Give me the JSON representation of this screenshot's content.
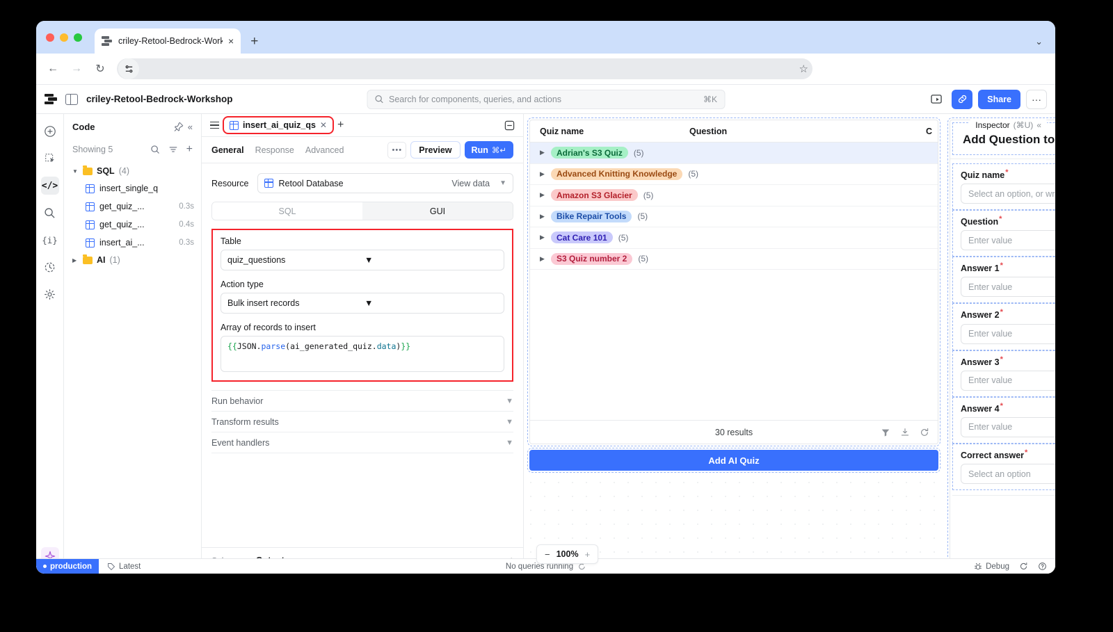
{
  "browser": {
    "tab_title": "criley-Retool-Bedrock-Works",
    "tab_close": "×",
    "new_tab": "+",
    "tabstrip_chevron": "⌄",
    "back": "←",
    "forward": "→",
    "reload": "↻",
    "address_value": "",
    "star": "☆"
  },
  "topbar": {
    "app_title": "criley-Retool-Bedrock-Workshop",
    "search_placeholder": "Search for components, queries, and actions",
    "search_kbd": "⌘K",
    "share_label": "Share",
    "more_label": "···"
  },
  "rail": {
    "items": [
      {
        "name": "add",
        "glyph": "⊕"
      },
      {
        "name": "components",
        "glyph": ""
      },
      {
        "name": "code",
        "glyph": "</>"
      },
      {
        "name": "search",
        "glyph": ""
      },
      {
        "name": "state",
        "glyph": "{i}"
      },
      {
        "name": "history",
        "glyph": ""
      },
      {
        "name": "settings",
        "glyph": ""
      }
    ],
    "ai_glyph": "✦"
  },
  "code_panel": {
    "title": "Code",
    "showing": "Showing 5",
    "folders": [
      {
        "label": "SQL",
        "count": "(4)",
        "expanded": true,
        "items": [
          {
            "name": "insert_single_q",
            "time": ""
          },
          {
            "name": "get_quiz_...",
            "time": "0.3s"
          },
          {
            "name": "get_quiz_...",
            "time": "0.4s"
          },
          {
            "name": "insert_ai_...",
            "time": "0.3s"
          }
        ]
      },
      {
        "label": "AI",
        "count": "(1)",
        "expanded": false,
        "items": []
      }
    ]
  },
  "editor": {
    "tab_name": "insert_ai_quiz_qs",
    "tab_close": "✕",
    "add_tab": "+",
    "subtabs": [
      {
        "label": "General",
        "active": true
      },
      {
        "label": "Response",
        "active": false
      },
      {
        "label": "Advanced",
        "active": false
      }
    ],
    "dots": "•••",
    "preview_label": "Preview",
    "run_label": "Run",
    "run_kbd": "⌘↵",
    "resource_label": "Resource",
    "resource_value": "Retool Database",
    "view_data_label": "View data",
    "mode_sql": "SQL",
    "mode_gui": "GUI",
    "table_label": "Table",
    "table_value": "quiz_questions",
    "action_type_label": "Action type",
    "action_type_value": "Bulk insert records",
    "array_label": "Array of records to insert",
    "code_tokens": [
      {
        "t": "{{",
        "c": "brace"
      },
      {
        "t": "JSON",
        "c": "ident"
      },
      {
        "t": ".",
        "c": "ident"
      },
      {
        "t": "parse",
        "c": "fn"
      },
      {
        "t": "(",
        "c": "ident"
      },
      {
        "t": "ai_generated_quiz",
        "c": "ident"
      },
      {
        "t": ".",
        "c": "ident"
      },
      {
        "t": "data",
        "c": "prop"
      },
      {
        "t": ")",
        "c": "ident"
      },
      {
        "t": "}}",
        "c": "brace"
      }
    ],
    "accordions": [
      "Run behavior",
      "Transform results",
      "Event handlers"
    ],
    "output_tabs": [
      {
        "label": "Schema",
        "active": false
      },
      {
        "label": "Output",
        "active": true
      }
    ]
  },
  "canvas": {
    "inspector_label": "Inspector",
    "inspector_kbd": "(⌘U)",
    "inspector_collapse": "«",
    "zoom_minus": "−",
    "zoom_level": "100%",
    "zoom_plus": "+",
    "add_ai_quiz_label": "Add AI Quiz",
    "table": {
      "columns": [
        "Quiz name",
        "Question",
        "C"
      ],
      "rows": [
        {
          "quiz": "Adrian's S3 Quiz",
          "count": "(5)",
          "bg": "#a6f0c6",
          "fg": "#0b6b3a",
          "selected": true
        },
        {
          "quiz": "Advanced Knitting Knowledge",
          "count": "(5)",
          "bg": "#fbd9b5",
          "fg": "#9a4a12",
          "selected": false
        },
        {
          "quiz": "Amazon S3 Glacier",
          "count": "(5)",
          "bg": "#fbc9c9",
          "fg": "#b3202a",
          "selected": false
        },
        {
          "quiz": "Bike Repair Tools",
          "count": "(5)",
          "bg": "#c3dbfb",
          "fg": "#1c4ea8",
          "selected": false
        },
        {
          "quiz": "Cat Care 101",
          "count": "(5)",
          "bg": "#c9c9fb",
          "fg": "#3020b3",
          "selected": false
        },
        {
          "quiz": "S3 Quiz number 2",
          "count": "(5)",
          "bg": "#fbc9d4",
          "fg": "#b3203f",
          "selected": false
        }
      ],
      "results_text": "30 results"
    },
    "form": {
      "title": "Add Question to Q",
      "fields": [
        {
          "label": "Quiz name",
          "required": true,
          "placeholder": "Select an option, or write"
        },
        {
          "label": "Question",
          "required": true,
          "placeholder": "Enter value"
        },
        {
          "label": "Answer 1",
          "required": true,
          "placeholder": "Enter value"
        },
        {
          "label": "Answer 2",
          "required": true,
          "placeholder": "Enter value"
        },
        {
          "label": "Answer 3",
          "required": true,
          "placeholder": "Enter value"
        },
        {
          "label": "Answer 4",
          "required": true,
          "placeholder": "Enter value"
        },
        {
          "label": "Correct answer",
          "required": true,
          "placeholder": "Select an option"
        }
      ]
    }
  },
  "statusbar": {
    "env": "production",
    "version": "Latest",
    "queries": "No queries running",
    "debug": "Debug"
  }
}
